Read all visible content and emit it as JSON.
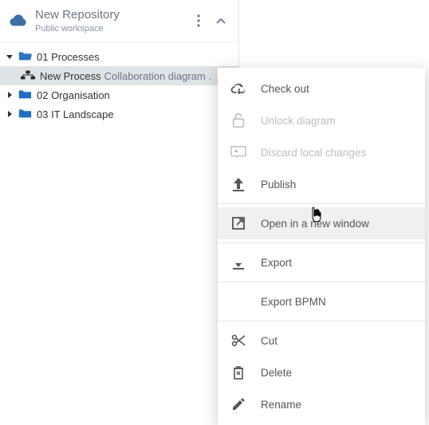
{
  "header": {
    "title": "New Repository",
    "subtitle": "Public workspace"
  },
  "tree": {
    "folder1": {
      "label": "01 Processes"
    },
    "item1": {
      "label": "New Process",
      "sub": "Collaboration diagram ."
    },
    "folder2": {
      "label": "02 Organisation"
    },
    "folder3": {
      "label": "03 IT Landscape"
    }
  },
  "menu": {
    "check_out": "Check out",
    "unlock": "Unlock diagram",
    "discard": "Discard local changes",
    "publish": "Publish",
    "open_new": "Open in a new window",
    "export": "Export",
    "export_bpmn": "Export BPMN",
    "cut": "Cut",
    "delete": "Delete",
    "rename": "Rename"
  }
}
